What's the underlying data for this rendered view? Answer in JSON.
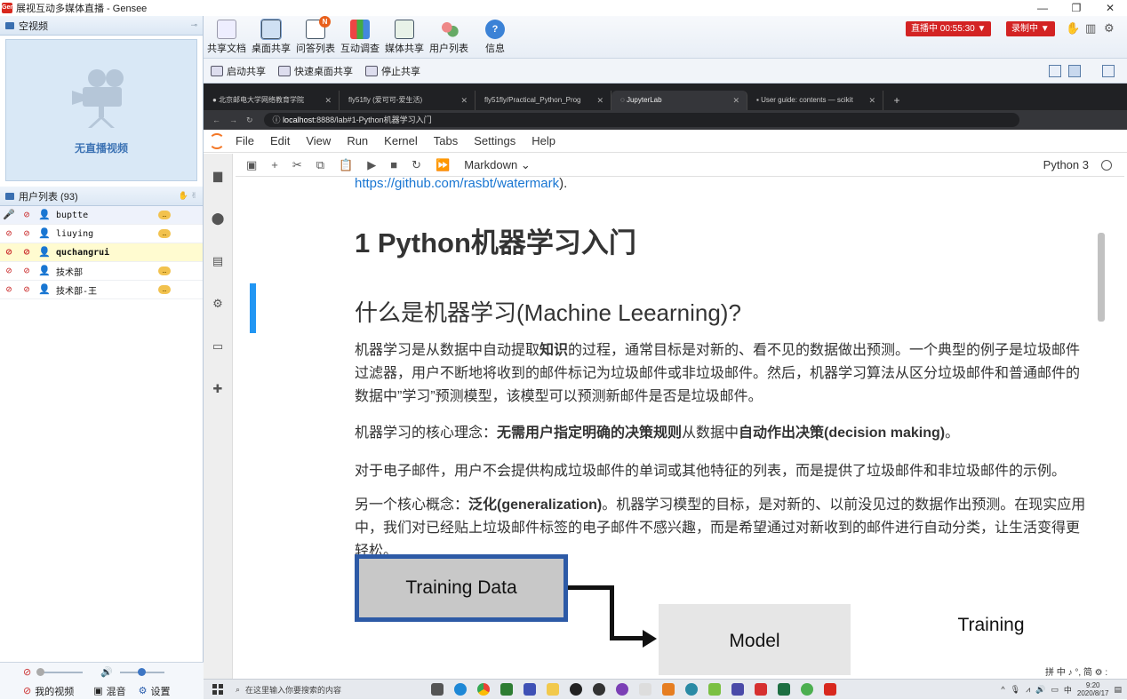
{
  "window": {
    "title": "展视互动多媒体直播 - Gensee",
    "app_icon": "Gen"
  },
  "left_panel": {
    "video_header": "空视频",
    "no_video_text": "无直播视频",
    "userlist_header": "用户列表 (93)",
    "users": [
      {
        "name": "buptte",
        "has_chat": true
      },
      {
        "name": "liuying",
        "has_chat": true
      },
      {
        "name": "quchangrui",
        "has_chat": false
      },
      {
        "name": "技术部",
        "has_chat": true
      },
      {
        "name": "技术部-王",
        "has_chat": true
      }
    ],
    "bottom": {
      "my_video": "我的视频",
      "mix": "混音",
      "settings": "设置"
    }
  },
  "toolbar": {
    "items": [
      {
        "label": "共享文档",
        "icon": "document-icon"
      },
      {
        "label": "桌面共享",
        "icon": "desktop-share-icon"
      },
      {
        "label": "问答列表",
        "icon": "qa-list-icon",
        "badge": "N"
      },
      {
        "label": "互动调查",
        "icon": "survey-icon"
      },
      {
        "label": "媒体共享",
        "icon": "media-share-icon"
      },
      {
        "label": "用户列表",
        "icon": "users-icon"
      },
      {
        "label": "信息",
        "icon": "info-icon"
      }
    ],
    "live_status": "直播中 00:55:30",
    "recording_status": "录制中"
  },
  "subtoolbar": {
    "start_share": "启动共享",
    "quick_share": "快速桌面共享",
    "stop_share": "停止共享"
  },
  "browser": {
    "tabs": [
      {
        "title": "北京邮电大学网络教育学院"
      },
      {
        "title": "fly51fly (爱可可-爱生活)"
      },
      {
        "title": "fly51fly/Practical_Python_Prog"
      },
      {
        "title": "JupyterLab"
      },
      {
        "title": "User guide: contents — scikit"
      }
    ],
    "url_host": "localhost",
    "url_rest": ":8888/lab#1-Python机器学习入门"
  },
  "jupyter": {
    "menu": [
      "File",
      "Edit",
      "View",
      "Run",
      "Kernel",
      "Tabs",
      "Settings",
      "Help"
    ],
    "cell_type": "Markdown",
    "kernel": "Python 3",
    "link_text": "https://github.com/rasbt/watermark",
    "link_suffix": ").",
    "h1": "1 Python机器学习入门",
    "h2": "什么是机器学习(Machine Leearning)?",
    "p1_a": "机器学习是从数据中自动提取",
    "p1_b": "知识",
    "p1_c": "的过程，通常目标是对新的、看不见的数据做出预测。一个典型的例子是垃圾邮件过滤器，用户不断地将收到的邮件标记为垃圾邮件或非垃圾邮件。然后，机器学习算法从区分垃圾邮件和普通邮件的数据中”学习”预测模型，该模型可以预测新邮件是否是垃圾邮件。",
    "p2_a": "机器学习的核心理念：",
    "p2_b": "无需用户指定明确的决策规则",
    "p2_c": "从数据中",
    "p2_d": "自动作出决策(decision making)",
    "p2_e": "。",
    "p3": "对于电子邮件，用户不会提供构成垃圾邮件的单词或其他特征的列表，而是提供了垃圾邮件和非垃圾邮件的示例。",
    "p4_a": "另一个核心概念：",
    "p4_b": "泛化(generalization)",
    "p4_c": "。机器学习模型的目标，是对新的、以前没见过的数据作出预测。在现实应用中，我们对已经贴上垃圾邮件标签的电子邮件不感兴趣，而是希望通过对新收到的邮件进行自动分类，让生活变得更轻松。",
    "diagram": {
      "training_data": "Training Data",
      "model": "Model",
      "training": "Training"
    }
  },
  "taskbar": {
    "search_placeholder": "在这里输入你要搜索的内容",
    "time": "9:20",
    "date": "2020/8/17",
    "ime": "中",
    "ime_bar": "拼 中 ♪ °, 简 ⚙ :"
  },
  "colors": {
    "accent": "#2196f3",
    "live_red": "#d32323",
    "diagram_border": "#2d5aa6"
  }
}
